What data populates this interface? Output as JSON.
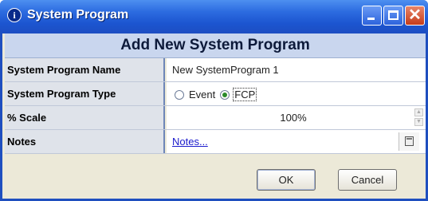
{
  "window": {
    "title": "System Program",
    "icon": "info-icon",
    "icon_glyph": "i",
    "controls": {
      "minimize": "minimize-icon",
      "maximize": "maximize-icon",
      "close": "close-icon",
      "close_glyph": "✕"
    }
  },
  "form": {
    "header": "Add New System Program",
    "rows": {
      "name": {
        "label": "System Program Name",
        "value": "New SystemProgram 1"
      },
      "type": {
        "label": "System Program Type",
        "options": [
          "Event",
          "FCP"
        ],
        "selected": "FCP"
      },
      "scale": {
        "label": "% Scale",
        "value": "100%"
      },
      "notes": {
        "label": "Notes",
        "link": "Notes..."
      }
    }
  },
  "buttons": {
    "ok": "OK",
    "cancel": "Cancel"
  },
  "colors": {
    "titlebar": "#2c6be0",
    "header_band": "#c9d6ee",
    "label_bg": "#dfe3ea",
    "link": "#1a1acc"
  }
}
